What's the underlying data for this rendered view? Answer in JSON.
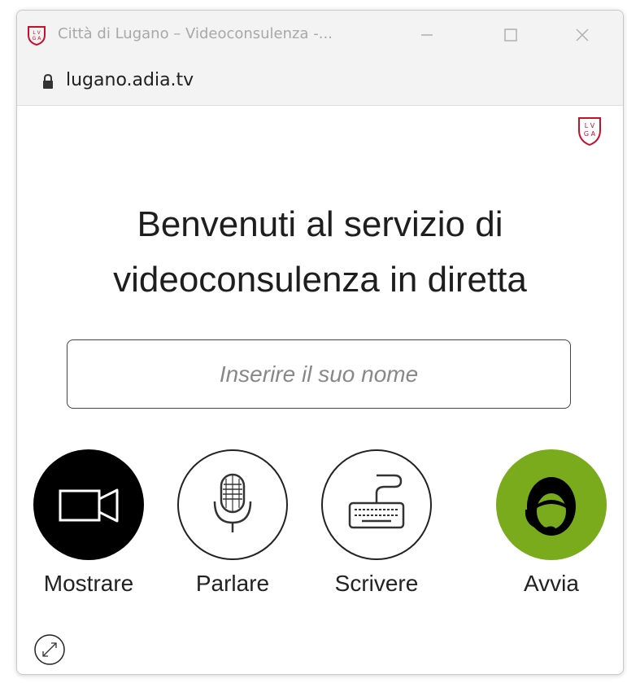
{
  "window": {
    "title": "Città di Lugano – Videoconsulenza -...",
    "url": "lugano.adia.tv"
  },
  "icons": {
    "app": "lugano-crest-icon",
    "lock": "lock-icon",
    "minimize": "minimize-icon",
    "maximize": "maximize-icon",
    "close": "close-icon",
    "brand": "lugano-crest-icon",
    "expand": "expand-icon"
  },
  "main": {
    "heading_line1": "Benvenuti al servizio di",
    "heading_line2": "videoconsulenza in diretta",
    "name_input": {
      "placeholder": "Inserire il suo nome",
      "value": ""
    }
  },
  "actions": [
    {
      "label": "Mostrare",
      "icon": "video-camera-icon",
      "style": "filled-black"
    },
    {
      "label": "Parlare",
      "icon": "microphone-icon",
      "style": "outline"
    },
    {
      "label": "Scrivere",
      "icon": "keyboard-icon",
      "style": "outline"
    },
    {
      "label": "Avvia",
      "icon": "headset-agent-icon",
      "style": "filled-green"
    }
  ],
  "colors": {
    "accent_green": "#7aab1c",
    "dark": "#000000",
    "brand_red": "#c8102e"
  }
}
